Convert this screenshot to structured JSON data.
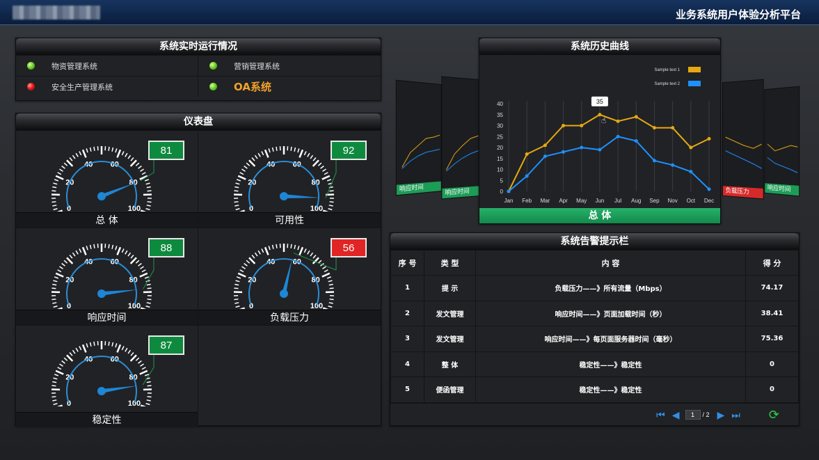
{
  "header": {
    "title": "业务系统用户体验分析平台"
  },
  "status_panel": {
    "title": "系统实时运行情况",
    "items": [
      {
        "name": "物资管理系统",
        "status": "green"
      },
      {
        "name": "营销管理系统",
        "status": "green"
      },
      {
        "name": "安全生产管理系统",
        "status": "red"
      },
      {
        "name": "OA系统",
        "status": "green"
      }
    ]
  },
  "dashboard": {
    "title": "仪表盘",
    "scale_labels": [
      "0",
      "20",
      "40",
      "60",
      "80",
      "100"
    ],
    "gauges": [
      {
        "label": "总 体",
        "value": "81",
        "level": 81,
        "alert": false
      },
      {
        "label": "可用性",
        "value": "92",
        "level": 92,
        "alert": false
      },
      {
        "label": "响应时间",
        "value": "88",
        "level": 88,
        "alert": false
      },
      {
        "label": "负载压力",
        "value": "56",
        "level": 56,
        "alert": true
      },
      {
        "label": "稳定性",
        "value": "87",
        "level": 87,
        "alert": false
      }
    ]
  },
  "history": {
    "title": "系统历史曲线",
    "footer_label": "总 体",
    "side_cards": [
      "响应时间",
      "响应时间",
      "负载压力",
      "响应时间"
    ],
    "tooltip": "35",
    "chart_data": {
      "type": "line",
      "categories": [
        "Jan",
        "Feb",
        "Mar",
        "Apr",
        "May",
        "Jun",
        "Jul",
        "Aug",
        "Sep",
        "Nov",
        "Oct",
        "Dec"
      ],
      "ylim": [
        0,
        40
      ],
      "yticks": [
        "0",
        "5",
        "10",
        "15",
        "20",
        "25",
        "30",
        "35",
        "40"
      ],
      "series": [
        {
          "name": "Sample text 1",
          "color": "#e7a812",
          "values": [
            0,
            17,
            21,
            30,
            30,
            35,
            32,
            34,
            29,
            29,
            20,
            24
          ]
        },
        {
          "name": "Sample text 2",
          "color": "#1e90ff",
          "values": [
            0,
            7,
            16,
            18,
            20,
            19,
            25,
            23,
            14,
            12,
            9,
            1
          ]
        }
      ],
      "legend_position": "top-right",
      "grid": "vertical"
    }
  },
  "alarm": {
    "title": "系统告警提示栏",
    "columns": [
      "序 号",
      "类 型",
      "内 容",
      "得 分"
    ],
    "rows": [
      [
        "1",
        "提 示",
        "负载压力——》所有流量（Mbps）",
        "74.17"
      ],
      [
        "2",
        "发文管理",
        "响应时间——》页面加载时间（秒）",
        "38.41"
      ],
      [
        "3",
        "发文管理",
        "响应时间——》每页面服务器时间（毫秒）",
        "75.36"
      ],
      [
        "4",
        "整 体",
        "稳定性——》稳定性",
        "0"
      ],
      [
        "5",
        "便函管理",
        "稳定性——》稳定性",
        "0"
      ]
    ],
    "pager": {
      "page": "1",
      "total": "/ 2"
    }
  }
}
